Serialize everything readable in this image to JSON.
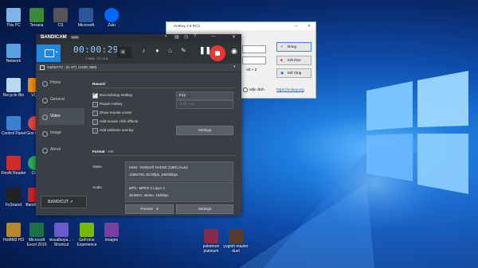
{
  "desktop_icons": [
    {
      "label": "This PC",
      "icon": "computer-icon",
      "color": "#7fb4e8"
    },
    {
      "label": "Terraria",
      "icon": "terraria-icon",
      "color": "#3a8a3a"
    },
    {
      "label": "CS",
      "icon": "cs-icon",
      "color": "#555555"
    },
    {
      "label": "Microsoft",
      "icon": "word-icon",
      "color": "#2b579a"
    },
    {
      "label": "Zalo",
      "icon": "zalo-icon",
      "color": "#0068ff"
    },
    {
      "label": "Network",
      "icon": "network-icon",
      "color": "#5aa0e0"
    },
    {
      "label": "Recycle Bin",
      "icon": "recycle-bin-icon",
      "color": "#bcd8f0"
    },
    {
      "label": "VLC",
      "icon": "vlc-icon",
      "color": "#f08a00"
    },
    {
      "label": "Control Panel",
      "icon": "control-panel-icon",
      "color": "#3d7fd0"
    },
    {
      "label": "Goo Chro",
      "icon": "chrome-icon",
      "color": "#e0463a"
    },
    {
      "label": "FireAt Reader",
      "icon": "reader-icon",
      "color": "#d42a2a"
    },
    {
      "label": "Cốc",
      "icon": "coccoc-icon",
      "color": "#2fa84f"
    },
    {
      "label": "FxSound",
      "icon": "fxsound-icon",
      "color": "#222222"
    },
    {
      "label": "Bandi - Sh",
      "icon": "bandicam-icon",
      "color": "#cc2222"
    },
    {
      "label": "HoMM3 HD",
      "icon": "homm-icon",
      "color": "#b8872a"
    },
    {
      "label": "Microsoft Excel 2010",
      "icon": "excel-icon",
      "color": "#1e7145"
    },
    {
      "label": "visualboya... - Shortcut",
      "icon": "visualboy-icon",
      "color": "#6a5acd"
    },
    {
      "label": "GeForce Experience",
      "icon": "geforce-icon",
      "color": "#76b900"
    },
    {
      "label": "images",
      "icon": "folder-icon",
      "color": "#7b3fa0"
    },
    {
      "label": "pokemon platinum",
      "icon": "pokemon-icon",
      "color": "#8a2a4a"
    },
    {
      "label": "yugioh master duel",
      "icon": "yugioh-icon",
      "color": "#5a3a2a"
    }
  ],
  "bandicam": {
    "logo": "BANDICAM",
    "logo_badge": "64bit",
    "timer": "00:00:29",
    "size": "1.3MB / 22.1GB",
    "resolution": "1440x773 - (0, 87), (1440, 860)",
    "sidebar": [
      "Home",
      "General",
      "Video",
      "Image",
      "About"
    ],
    "active_item": "Video",
    "record_section": "Record",
    "options": [
      {
        "label": "Record/Stop Hotkey",
        "checked": true
      },
      {
        "label": "Pause Hotkey",
        "checked": false
      },
      {
        "label": "Show mouse cursor",
        "checked": false
      },
      {
        "label": "Add mouse click effects",
        "checked": false
      },
      {
        "label": "Add webcam overlay",
        "checked": false
      }
    ],
    "hotkey_value": "F12",
    "pause_hotkey_value": "Shift+F12",
    "settings_button": "Settings",
    "format_section": "Format",
    "format_value": "- AVI",
    "video_label": "Video",
    "video_line1": "H264 - NVIDIA® NVENC (CBR) (Auto)",
    "video_line2": "1280x720, 60.00fps, 10000kbps",
    "audio_label": "Audio",
    "audio_line1": "MP3 - MPEG-1 Layer 3",
    "audio_line2": "48.0KHz, stereo, 192kbps",
    "presets_button": "Presets",
    "settings_button_2": "Settings",
    "bandicut_label": "BANDICUT ↗",
    "accent": "#1e88e5",
    "record_color": "#e53935"
  },
  "unikey": {
    "title": "UniKey 4.6 RC2",
    "dong": "Đóng",
    "ket_thuc": "Kết thúc",
    "mo_rong": "Mở rộng",
    "shortcut": "Alt + Z",
    "mac_dinh": "Mặc định",
    "url": "https://unikey.org"
  }
}
